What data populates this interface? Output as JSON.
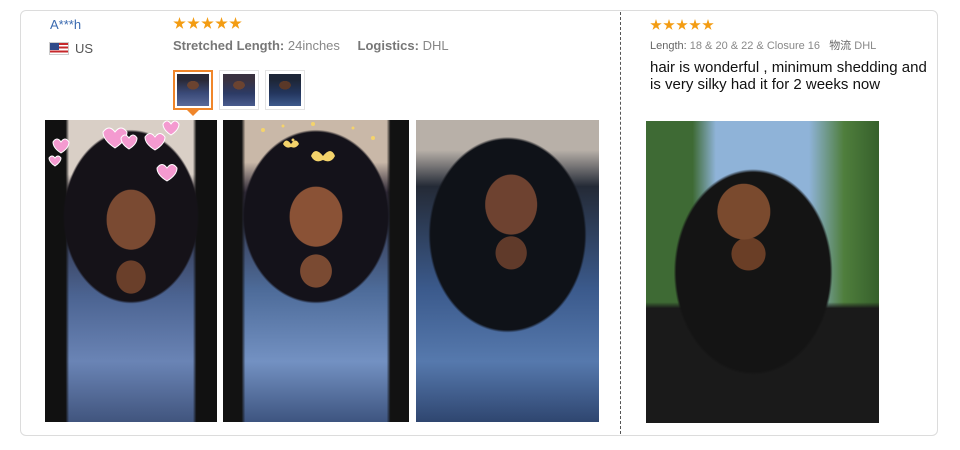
{
  "review1": {
    "user_name": "A***h",
    "country": "US",
    "rating": 5,
    "stretched_label": "Stretched Length:",
    "stretched_value": "24inches",
    "logistics_label": "Logistics:",
    "logistics_value": "DHL",
    "thumbnail_count": 3,
    "active_thumbnail": 1,
    "photo_count": 3
  },
  "review2": {
    "rating": 5,
    "length_label": "Length:",
    "length_value": "18 & 20 & 22 & Closure 16",
    "logistics_label": "物流",
    "logistics_value": "DHL",
    "text": "hair is wonderful , minimum shedding and is very silky had it for 2 weeks now",
    "photo_count": 1
  },
  "colors": {
    "star": "#f39c12",
    "accent": "#f0862a",
    "username": "#3a6ab0"
  }
}
